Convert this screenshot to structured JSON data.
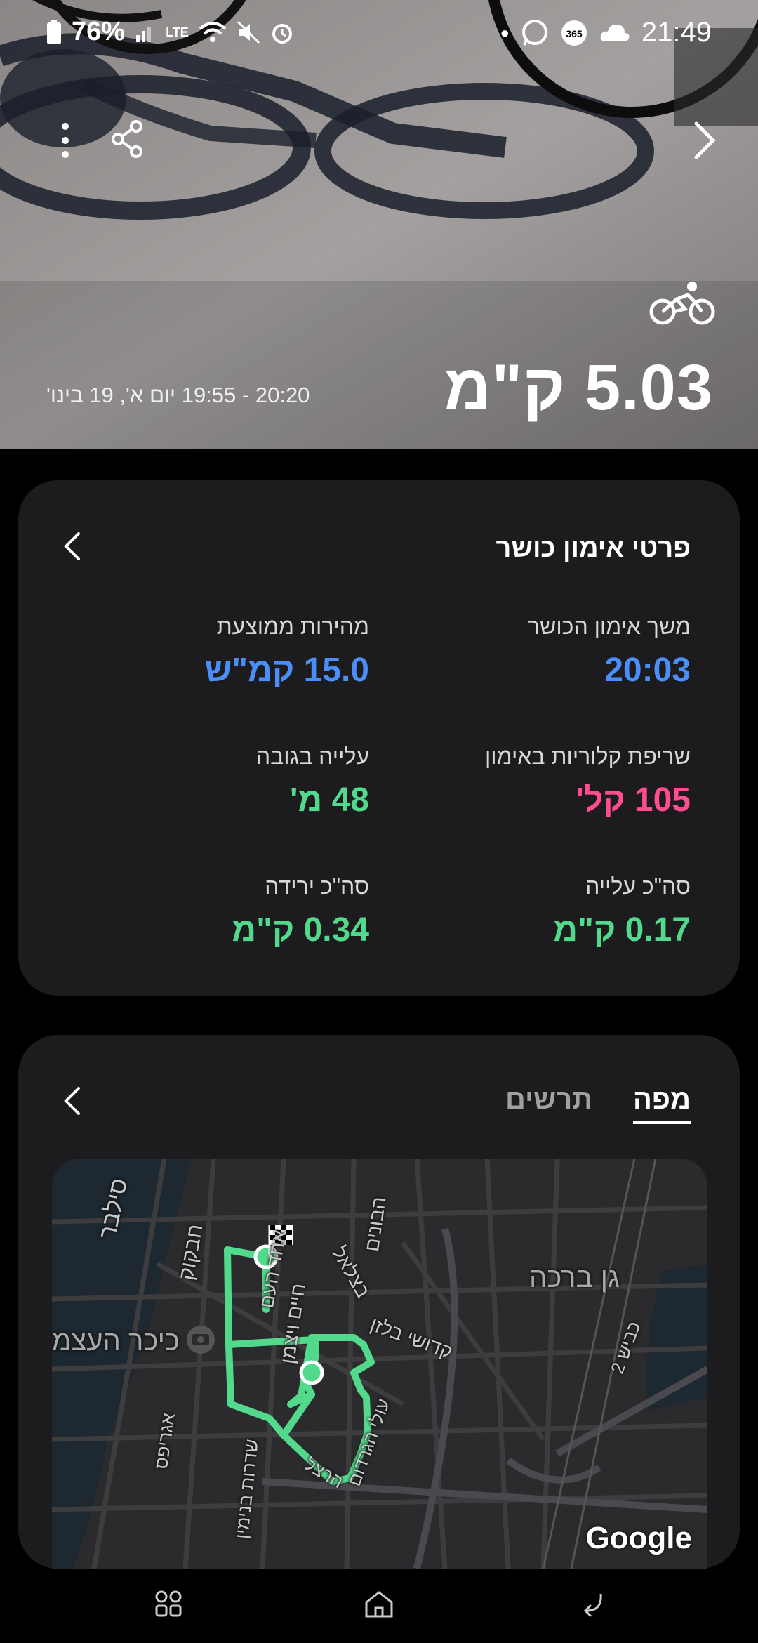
{
  "status_bar": {
    "battery": "76%",
    "time": "21:49",
    "network_label": "LTE"
  },
  "hero": {
    "distance": "5.03 ק\"מ",
    "time_range": "20:20 - 19:55 יום א', 19 בינו'",
    "icons": [
      "more-icon",
      "share-icon",
      "chevron-right-icon",
      "cycling-icon"
    ]
  },
  "workout_details": {
    "title": "פרטי אימון כושר",
    "stats": [
      {
        "label": "משך אימון הכושר",
        "value": "20:03",
        "color": "#4a8ff7"
      },
      {
        "label": "מהירות ממוצעת",
        "value": "15.0 קמ\"ש",
        "color": "#4a8ff7"
      },
      {
        "label": "שריפת קלוריות באימון",
        "value": "105 קל'",
        "color": "#ff4d8d"
      },
      {
        "label": "עלייה בגובה",
        "value": "48 מ'",
        "color": "#52d98c"
      },
      {
        "label": "סה\"כ עלייה",
        "value": "0.17 ק\"מ",
        "color": "#52d98c"
      },
      {
        "label": "סה\"כ ירידה",
        "value": "0.34 ק\"מ",
        "color": "#52d98c"
      }
    ]
  },
  "map_card": {
    "tabs": [
      "מפה",
      "תרשים"
    ],
    "active_tab": "מפה",
    "map_labels": {
      "gan_bracha": "גן ברכה",
      "kikar": "כיכר העצמ",
      "stanley": "סילבר",
      "habakuk": "חבקוק",
      "achad_haam": "אחד העם",
      "weizmann": "חיים ויצמן",
      "bezalel": "בצלאל",
      "kaduri": "קדושי בלזן",
      "habonim": "הבונים",
      "agripas": "אגריפס",
      "sderot": "שדרות בנימין",
      "hertzl": "הרצל",
      "olei": "עולי הגרדום",
      "kvish": "כביש 2",
      "google": "Google"
    },
    "route_color": "#52d98c"
  },
  "nav_bar": {
    "icons": [
      "recent-apps-icon",
      "home-icon",
      "back-icon"
    ]
  }
}
